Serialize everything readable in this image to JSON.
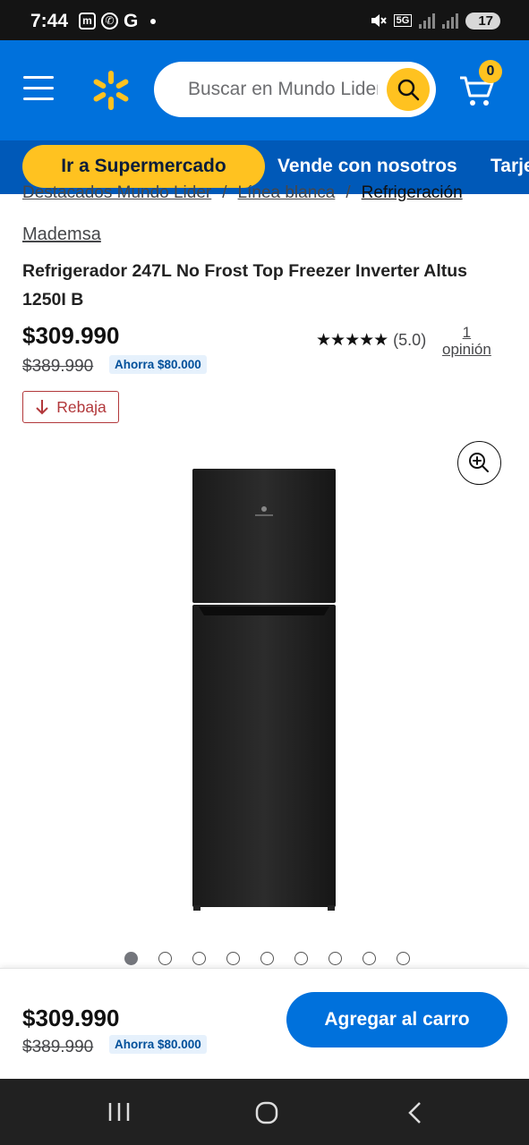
{
  "status_bar": {
    "time": "7:44",
    "network": "5G",
    "battery": "17"
  },
  "header": {
    "search_placeholder": "Buscar en Mundo Lider",
    "cart_count": "0"
  },
  "nav": {
    "supermarket_label": "Ir a Supermercado",
    "sell_label": "Vende con nosotros",
    "card_label": "Tarjeta"
  },
  "breadcrumb": [
    "Destacados Mundo Lider",
    "Línea blanca",
    "Refrigeración"
  ],
  "breadcrumb_separator": "/",
  "product": {
    "brand": "Mademsa",
    "title": "Refrigerador 247L No Frost Top Freezer Inverter Altus 1250I B",
    "price": "$309.990",
    "was_price": "$389.990",
    "savings": "Ahorra $80.000",
    "rating": 5.0,
    "stars": "★★★★★",
    "rating_label": "(5.0)",
    "reviews_count": "1",
    "reviews_label": "opinión",
    "badge": "Rebaja",
    "image_count": 9,
    "active_image": 1
  },
  "bottom_bar": {
    "price": "$309.990",
    "was_price": "$389.990",
    "savings": "Ahorra $80.000",
    "add_to_cart": "Agregar al carro"
  },
  "colors": {
    "brand_blue": "#0071dc",
    "nav_blue": "#0059b8",
    "spark_yellow": "#ffc220",
    "sale_red": "#b2383b"
  }
}
